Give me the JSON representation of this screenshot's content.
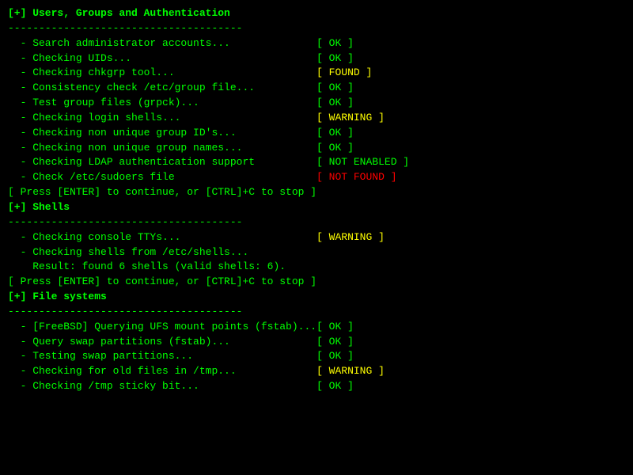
{
  "terminal": {
    "sections": [
      {
        "id": "users-groups-auth",
        "header": "[+] Users, Groups and Authentication",
        "separator": "--------------------------------------",
        "items": [
          {
            "label": "  - Search administrator accounts...",
            "status": "[ OK ]",
            "statusClass": "status-ok"
          },
          {
            "label": "  - Checking UIDs...",
            "status": "[ OK ]",
            "statusClass": "status-ok"
          },
          {
            "label": "  - Checking chkgrp tool...",
            "status": "[ FOUND ]",
            "statusClass": "status-found"
          },
          {
            "label": "  - Consistency check /etc/group file...",
            "status": "[ OK ]",
            "statusClass": "status-ok"
          },
          {
            "label": "  - Test group files (grpck)...",
            "status": "[ OK ]",
            "statusClass": "status-ok"
          },
          {
            "label": "  - Checking login shells...",
            "status": "[ WARNING ]",
            "statusClass": "status-warning"
          },
          {
            "label": "  - Checking non unique group ID's...",
            "status": "[ OK ]",
            "statusClass": "status-ok"
          },
          {
            "label": "  - Checking non unique group names...",
            "status": "[ OK ]",
            "statusClass": "status-ok"
          },
          {
            "label": "  - Checking LDAP authentication support",
            "status": "[ NOT ENABLED ]",
            "statusClass": "status-not-enabled"
          },
          {
            "label": "  - Check /etc/sudoers file",
            "status": "[ NOT FOUND ]",
            "statusClass": "status-not-found"
          }
        ],
        "prompt": "[ Press [ENTER] to continue, or [CTRL]+C to stop ]"
      },
      {
        "id": "shells",
        "header": "[+] Shells",
        "separator": "--------------------------------------",
        "items": [
          {
            "label": "  - Checking console TTYs...",
            "status": "[ WARNING ]",
            "statusClass": "status-warning"
          },
          {
            "label": "  - Checking shells from /etc/shells...",
            "status": "",
            "statusClass": ""
          },
          {
            "label": "    Result: found 6 shells (valid shells: 6).",
            "status": "",
            "statusClass": ""
          }
        ],
        "prompt": "[ Press [ENTER] to continue, or [CTRL]+C to stop ]"
      },
      {
        "id": "file-systems",
        "header": "[+] File systems",
        "separator": "--------------------------------------",
        "items": [
          {
            "label": "  - [FreeBSD] Querying UFS mount points (fstab)...",
            "status": "[ OK ]",
            "statusClass": "status-ok"
          },
          {
            "label": "  - Query swap partitions (fstab)...",
            "status": "[ OK ]",
            "statusClass": "status-ok"
          },
          {
            "label": "  - Testing swap partitions...",
            "status": "[ OK ]",
            "statusClass": "status-ok"
          },
          {
            "label": "  - Checking for old files in /tmp...",
            "status": "[ WARNING ]",
            "statusClass": "status-warning"
          },
          {
            "label": "  - Checking /tmp sticky bit...",
            "status": "[ OK ]",
            "statusClass": "status-ok"
          }
        ],
        "prompt": ""
      }
    ]
  }
}
